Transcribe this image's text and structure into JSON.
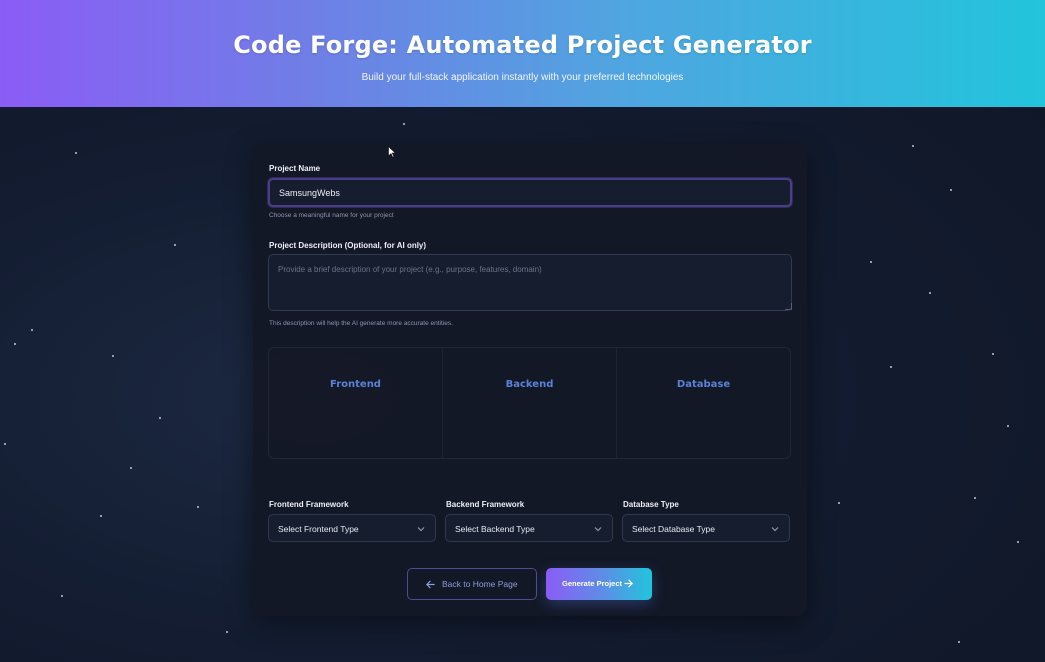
{
  "header": {
    "title": "Code Forge: Automated Project Generator",
    "subtitle": "Build your full-stack application instantly with your preferred technologies"
  },
  "form": {
    "project_name": {
      "label": "Project Name",
      "value": "SamsungWebs",
      "hint": "Choose a meaningful name for your project"
    },
    "description": {
      "label": "Project Description (Optional, for AI only)",
      "placeholder": "Provide a brief description of your project (e.g., purpose, features, domain)",
      "hint": "This description will help the AI generate more accurate entities."
    },
    "tech_panel": {
      "columns": [
        "Frontend",
        "Backend",
        "Database"
      ]
    },
    "selects": {
      "frontend": {
        "label": "Frontend Framework",
        "value": "Select Frontend Type"
      },
      "backend": {
        "label": "Backend Framework",
        "value": "Select Backend Type"
      },
      "database": {
        "label": "Database Type",
        "value": "Select Database Type"
      }
    },
    "buttons": {
      "back_label": "Back to Home Page",
      "back_icon": "arrow-left-icon",
      "generate_label": "Generate Project",
      "generate_icon": "arrow-right-icon"
    }
  },
  "colors": {
    "header_gradient_start": "#8b5cf6",
    "header_gradient_end": "#22c4dc",
    "background": "#131c30",
    "card": "#131826",
    "tech_heading": "#5b82d6"
  }
}
